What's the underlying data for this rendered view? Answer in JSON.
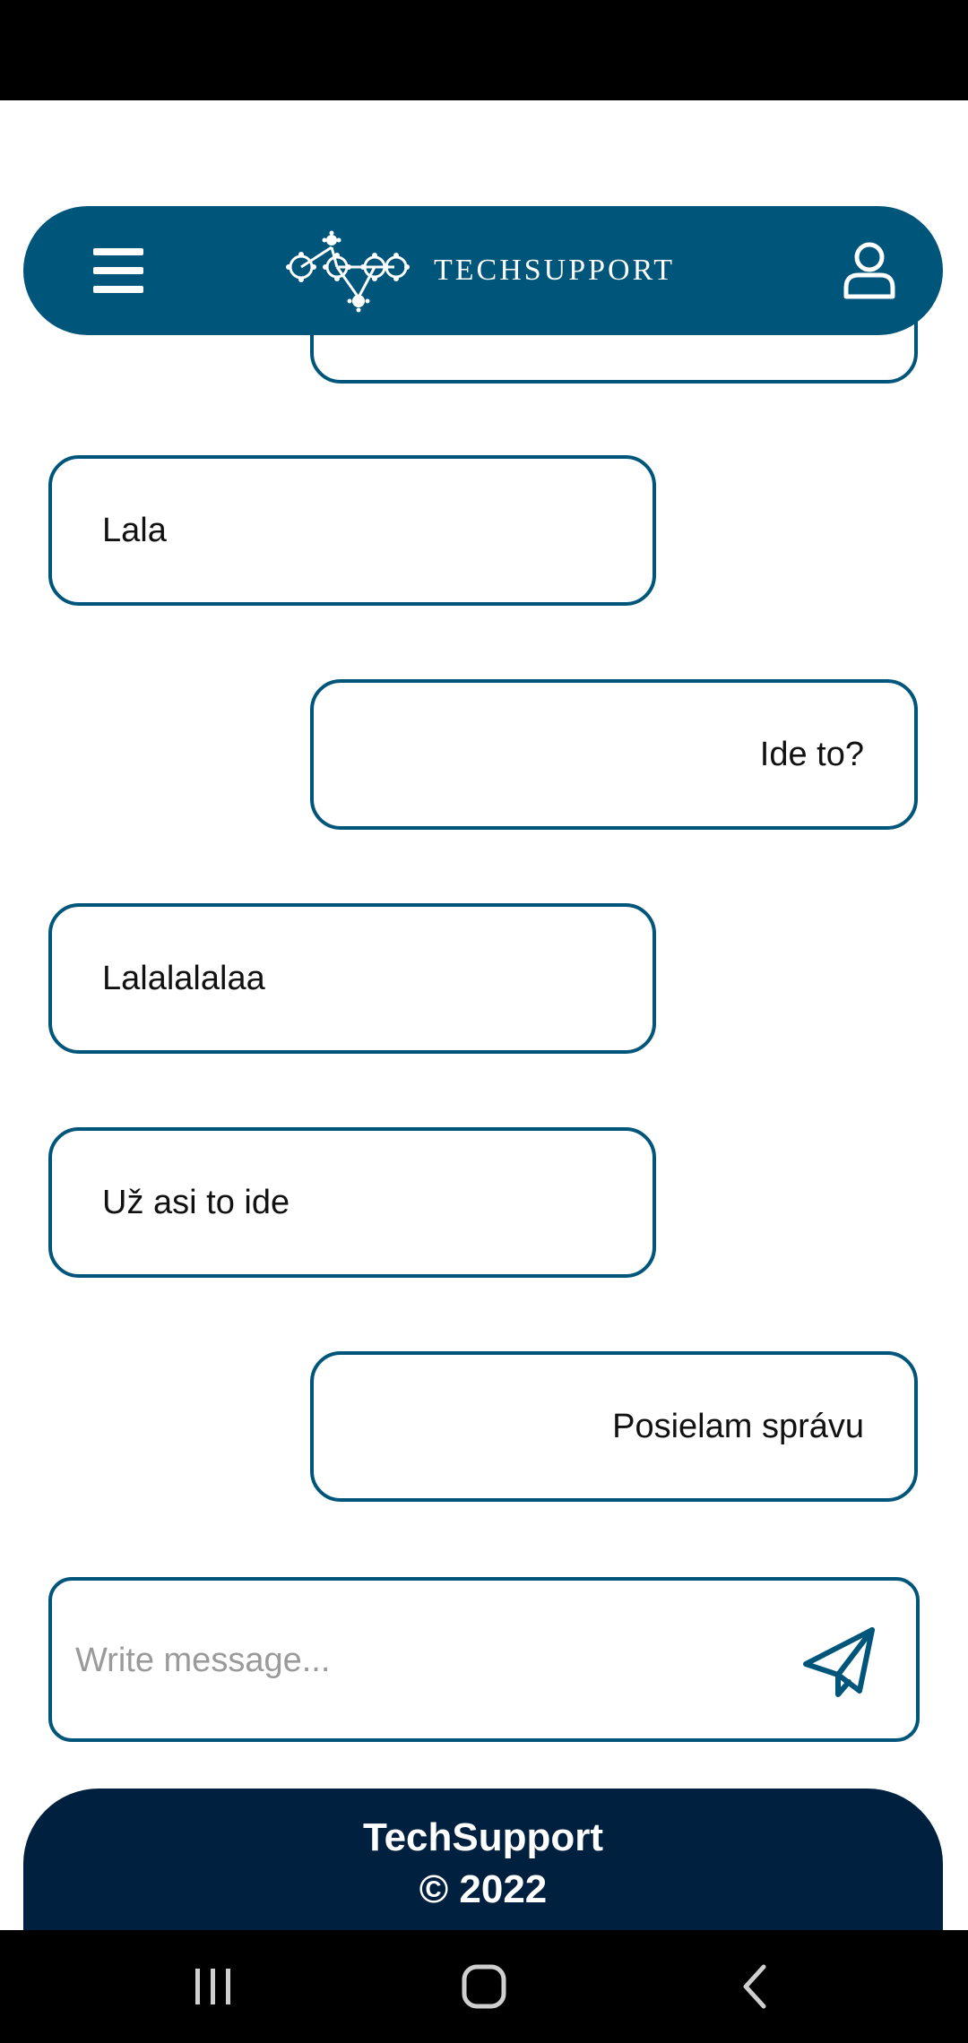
{
  "header": {
    "brand_name": "TECHSUPPORT",
    "menu_icon": "hamburger-menu-icon",
    "user_icon": "user-profile-icon",
    "logo_icon": "gears-network-logo"
  },
  "messages": [
    {
      "side": "right",
      "text": ""
    },
    {
      "side": "left",
      "text": "Lala"
    },
    {
      "side": "right",
      "text": "Ide to?"
    },
    {
      "side": "left",
      "text": "Lalalalalaa"
    },
    {
      "side": "left",
      "text": "Už asi to ide"
    },
    {
      "side": "right",
      "text": "Posielam správu"
    }
  ],
  "composer": {
    "placeholder": "Write message...",
    "value": "",
    "send_icon": "paper-plane-icon"
  },
  "footer": {
    "title": "TechSupport",
    "copyright": "© 2022"
  },
  "navigation": {
    "recents_icon": "recents-icon",
    "home_icon": "home-icon",
    "back_icon": "back-icon"
  },
  "colors": {
    "primary": "#00557a",
    "footer_bg": "#00203f",
    "system_bar": "#000000",
    "placeholder": "#9a9a9a"
  }
}
